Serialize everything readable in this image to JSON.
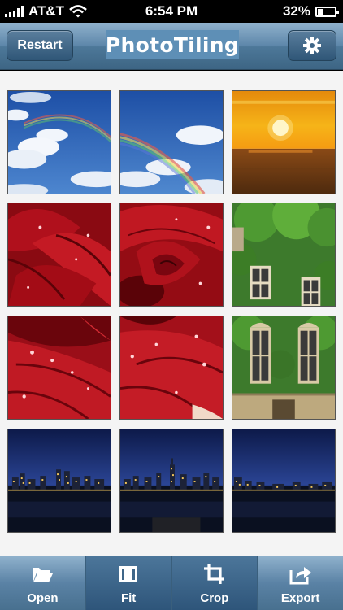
{
  "status_bar": {
    "carrier": "AT&T",
    "time": "6:54 PM",
    "battery_percent": "32%",
    "battery_level": 0.32
  },
  "nav": {
    "restart_label": "Restart",
    "title": "PhotoTiling",
    "settings_icon": "gear-icon"
  },
  "toolbar": {
    "items": [
      {
        "label": "Open",
        "icon": "folder-open-icon",
        "active": false
      },
      {
        "label": "Fit",
        "icon": "fit-icon",
        "active": true
      },
      {
        "label": "Crop",
        "icon": "crop-icon",
        "active": true
      },
      {
        "label": "Export",
        "icon": "export-icon",
        "active": false
      }
    ]
  },
  "tiles": [
    {
      "subject": "blue sky with rainbow (left)"
    },
    {
      "subject": "blue sky with rainbow (right)"
    },
    {
      "subject": "sunset over ocean"
    },
    {
      "subject": "red rose (top-left)"
    },
    {
      "subject": "red rose (top-center)"
    },
    {
      "subject": "ivy-covered building (top)"
    },
    {
      "subject": "red rose (bottom-left)"
    },
    {
      "subject": "red rose (bottom-center)"
    },
    {
      "subject": "ivy-covered building (bottom)"
    },
    {
      "subject": "night city skyline (left)"
    },
    {
      "subject": "night city skyline (center)"
    },
    {
      "subject": "night city skyline (right)"
    }
  ]
}
